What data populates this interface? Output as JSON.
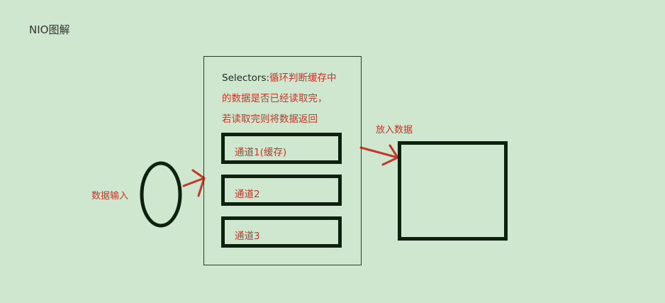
{
  "diagram": {
    "title": "NIO图解",
    "input_label": "数据输入",
    "selector": {
      "title": "Selectors:",
      "desc_line1": "循环判断缓存中",
      "desc_line2": "的数据是否已经读取完，",
      "desc_line3": "若读取完则将数据返回"
    },
    "channels": [
      {
        "label": "通道1(缓存)"
      },
      {
        "label": "通道2"
      },
      {
        "label": "通道3"
      }
    ],
    "output_label": "放入数据"
  },
  "colors": {
    "background": "#cfe6cf",
    "annotation_red": "#c0392b",
    "shape_dark": "#0e200e",
    "text_dark": "#333333"
  }
}
